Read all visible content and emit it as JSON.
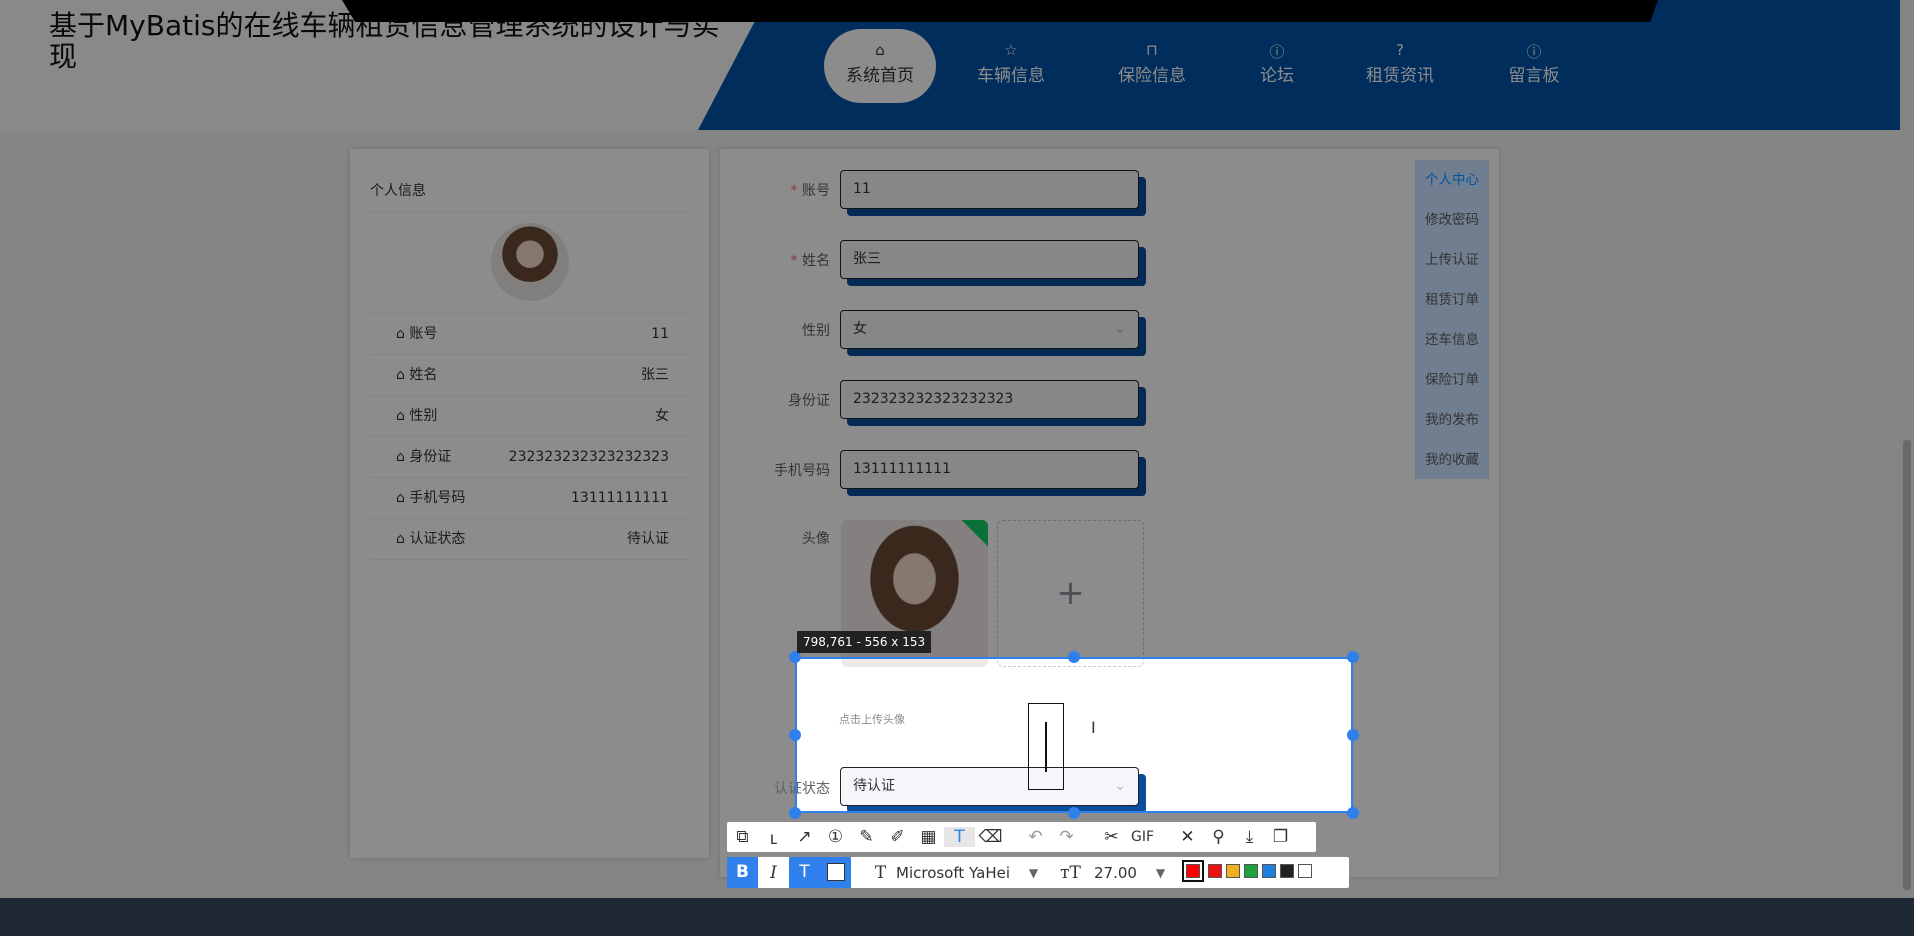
{
  "header": {
    "title": "基于MyBatis的在线车辆租赁信息管理系统的设计与实现",
    "nav": [
      {
        "label": "系统首页",
        "icon": "home-icon"
      },
      {
        "label": "车辆信息",
        "icon": "star-icon"
      },
      {
        "label": "保险信息",
        "icon": "bag-icon"
      },
      {
        "label": "论坛",
        "icon": "info-icon"
      },
      {
        "label": "租赁资讯",
        "icon": "question-icon"
      },
      {
        "label": "留言板",
        "icon": "info-icon"
      }
    ]
  },
  "profile": {
    "title": "个人信息",
    "rows": [
      {
        "k": "账号",
        "v": "11"
      },
      {
        "k": "姓名",
        "v": "张三"
      },
      {
        "k": "性别",
        "v": "女"
      },
      {
        "k": "身份证",
        "v": "232323232323232323"
      },
      {
        "k": "手机号码",
        "v": "13111111111"
      },
      {
        "k": "认证状态",
        "v": "待认证"
      }
    ]
  },
  "form": {
    "account_label": "账号",
    "account": "11",
    "name_label": "姓名",
    "name": "张三",
    "gender_label": "性别",
    "gender": "女",
    "id_label": "身份证",
    "id": "232323232323232323",
    "phone_label": "手机号码",
    "phone": "13111111111",
    "avatar_label": "头像",
    "upload_hint": "点击上传头像",
    "status_label": "认证状态",
    "status": "待认证",
    "required": "*"
  },
  "menu": [
    "个人中心",
    "修改密码",
    "上传认证",
    "租赁订单",
    "还车信息",
    "保险订单",
    "我的发布",
    "我的收藏"
  ],
  "capture": {
    "size_tag": "798,761 - 556 x 153",
    "font": "Microsoft YaHei",
    "font_size": "27.00",
    "gif": "GIF",
    "bold": "B",
    "italic": "I",
    "colors": [
      "#ff0000",
      "#e81010",
      "#f0b020",
      "#20a040",
      "#2080e0",
      "#202020",
      "#ffffff"
    ]
  }
}
